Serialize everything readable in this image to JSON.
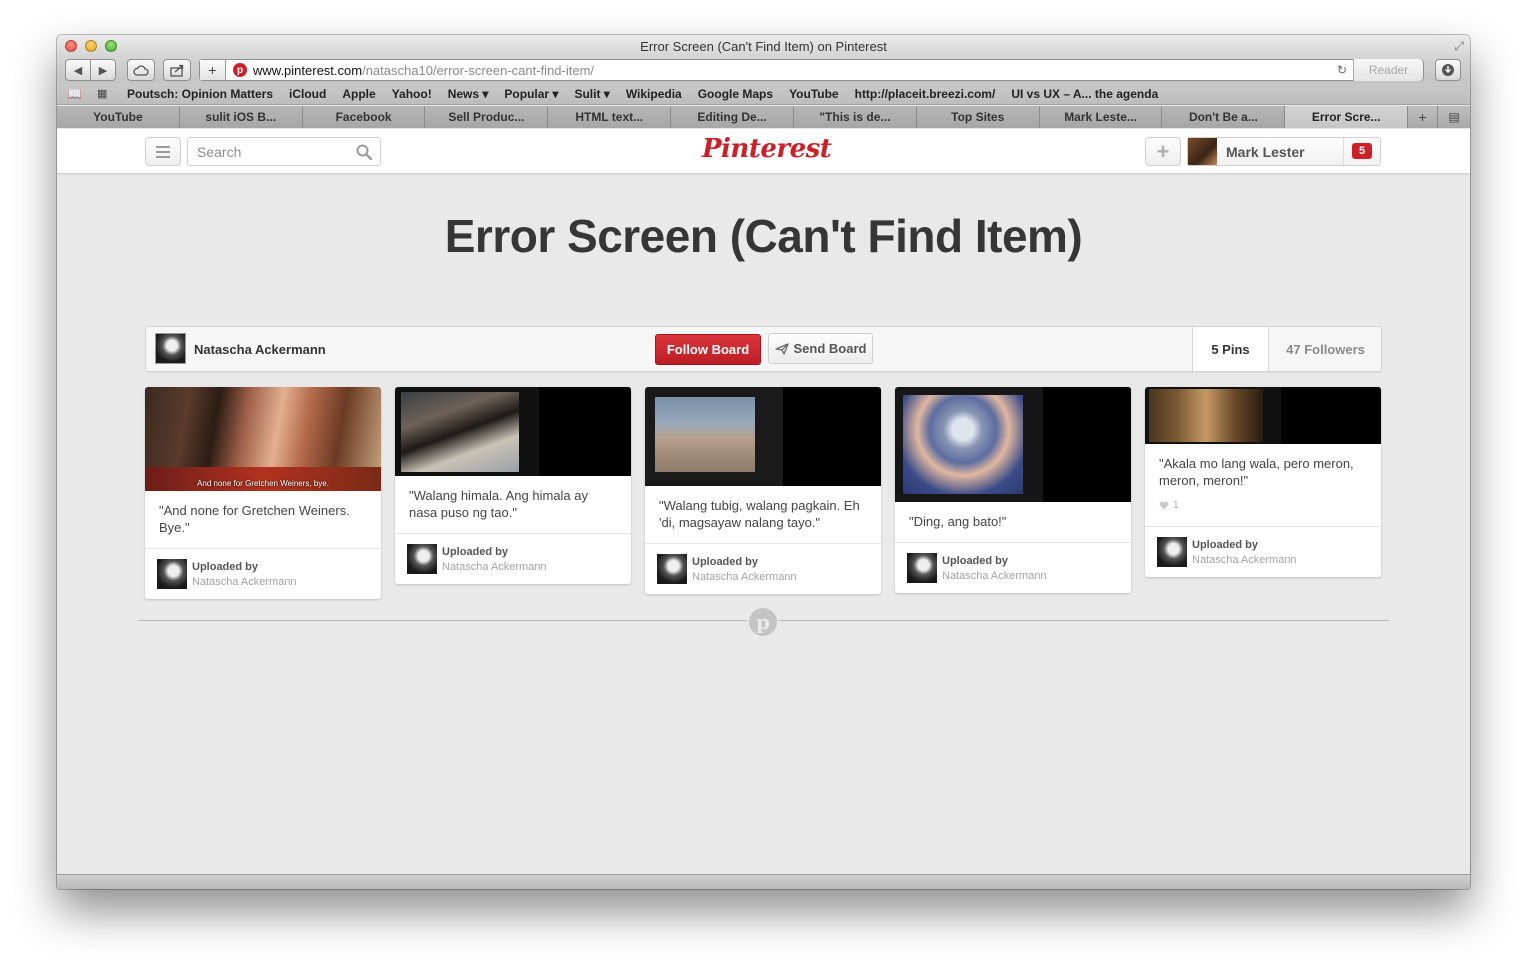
{
  "window": {
    "title": "Error Screen (Can't Find Item) on Pinterest"
  },
  "toolbar": {
    "url_host": "www.pinterest.com",
    "url_path": "/natascha10/error-screen-cant-find-item/",
    "reader_label": "Reader"
  },
  "bookmarks": [
    "Poutsch: Opinion Matters",
    "iCloud",
    "Apple",
    "Yahoo!",
    "News ▾",
    "Popular ▾",
    "Sulit ▾",
    "Wikipedia",
    "Google Maps",
    "YouTube",
    "http://placeit.breezi.com/",
    "UI vs UX – A... the agenda"
  ],
  "tabs": [
    "YouTube",
    "sulit iOS B...",
    "Facebook",
    "Sell Produc...",
    "HTML text...",
    "Editing De...",
    "\"This is de...",
    "Top Sites",
    "Mark Leste...",
    "Don't Be a...",
    "Error Scre..."
  ],
  "header": {
    "search_placeholder": "Search",
    "logo_text": "Pinterest",
    "user_name": "Mark Lester",
    "notification_count": "5"
  },
  "board": {
    "title": "Error Screen (Can't Find Item)",
    "owner": "Natascha Ackermann",
    "follow_label": "Follow Board",
    "send_label": "Send Board",
    "pins_count": "5 Pins",
    "followers_count": "47 Followers"
  },
  "pins": [
    {
      "description": "\"And none for Gretchen Weiners. Bye.\"",
      "subtitle": "And none for Gretchen Weiners, bye.",
      "uploaded_label": "Uploaded by",
      "uploader": "Natascha Ackermann"
    },
    {
      "description": "\"Walang himala. Ang himala ay nasa puso ng tao.\"",
      "uploaded_label": "Uploaded by",
      "uploader": "Natascha Ackermann"
    },
    {
      "description": "\"Walang tubig, walang pagkain. Eh 'di, magsayaw nalang tayo.\"",
      "uploaded_label": "Uploaded by",
      "uploader": "Natascha Ackermann"
    },
    {
      "description": "\"Ding, ang bato!\"",
      "uploaded_label": "Uploaded by",
      "uploader": "Natascha Ackermann"
    },
    {
      "description": "\"Akala mo lang wala, pero meron, meron, meron!\"",
      "likes": "1",
      "uploaded_label": "Uploaded by",
      "uploader": "Natascha Ackermann"
    }
  ],
  "colors": {
    "pinterest_red": "#cb2027",
    "page_bg": "#e9e9e9",
    "title_text": "#363636"
  }
}
